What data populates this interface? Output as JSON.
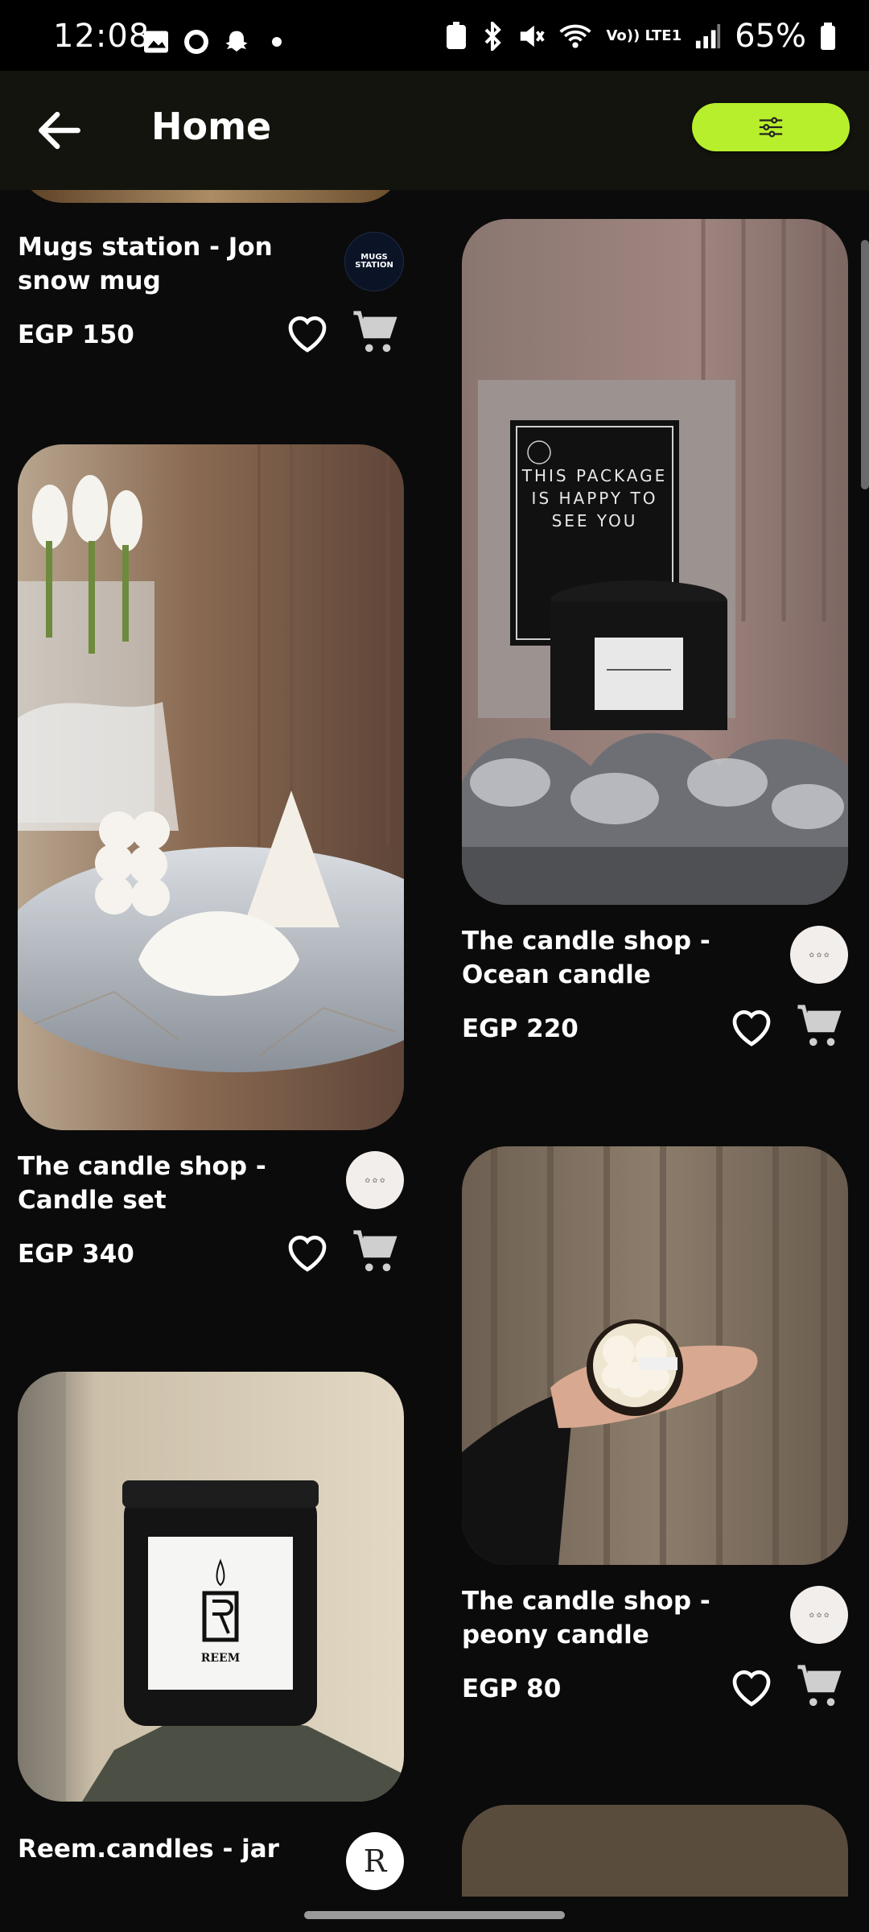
{
  "status_bar": {
    "time": "12:08",
    "battery": "65%",
    "network": "Vo)) LTE1"
  },
  "app_bar": {
    "title": "Home"
  },
  "products": [
    {
      "shop": "Mugs station",
      "title": "Mugs station  - Jon snow mug",
      "price": "EGP 150"
    },
    {
      "shop": "The candle shop",
      "title": "The candle shop - Candle set",
      "price": "EGP 340"
    },
    {
      "shop": "Reem.candles",
      "title": "Reem.candles - jar",
      "price": ""
    },
    {
      "shop": "The candle shop",
      "title": "The candle shop - Ocean candle",
      "price": "EGP 220"
    },
    {
      "shop": "The candle shop",
      "title": "The candle shop - peony candle",
      "price": "EGP 80"
    }
  ],
  "image_text": {
    "package_sign": "THIS PACKAGE IS HAPPY TO SEE YOU",
    "reem_label": "REEM",
    "mugs_logo": "MUGS STATION"
  },
  "colors": {
    "accent": "#b8ef2c",
    "background": "#0b0b0b",
    "appbar": "#13140d"
  },
  "icons": [
    "back-arrow-icon",
    "filter-sliders-icon",
    "heart-icon",
    "cart-icon"
  ]
}
